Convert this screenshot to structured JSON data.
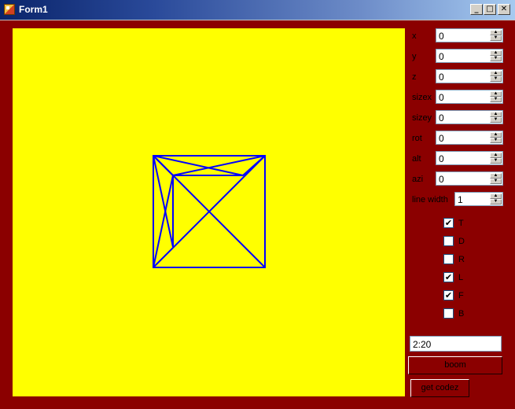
{
  "window": {
    "title": "Form1"
  },
  "titlebar_buttons": {
    "minimize": "_",
    "maximize": "□",
    "close": "✕"
  },
  "colors": {
    "form_background": "#8b0000",
    "canvas_background": "#ffff00",
    "drawing_stroke": "#0000ff"
  },
  "fields": [
    {
      "label": "x",
      "value": "0"
    },
    {
      "label": "y",
      "value": "0"
    },
    {
      "label": "z",
      "value": "0"
    },
    {
      "label": "sizex",
      "value": "0"
    },
    {
      "label": "sizey",
      "value": "0"
    },
    {
      "label": "rot",
      "value": "0"
    },
    {
      "label": "alt",
      "value": "0"
    },
    {
      "label": "azi",
      "value": "0"
    }
  ],
  "line_width": {
    "label": "line width",
    "value": "1"
  },
  "spin_glyphs": {
    "up": "▲",
    "down": "▼"
  },
  "faces": [
    {
      "label": "T",
      "checked": true,
      "mark": "✔"
    },
    {
      "label": "D",
      "checked": false,
      "mark": ""
    },
    {
      "label": "R",
      "checked": false,
      "mark": ""
    },
    {
      "label": "L",
      "checked": true,
      "mark": "✔"
    },
    {
      "label": "F",
      "checked": true,
      "mark": "✔"
    },
    {
      "label": "B",
      "checked": false,
      "mark": ""
    }
  ],
  "text_input": {
    "value": "2:20"
  },
  "buttons": {
    "boom": "boom",
    "get_codez": "get codez"
  }
}
